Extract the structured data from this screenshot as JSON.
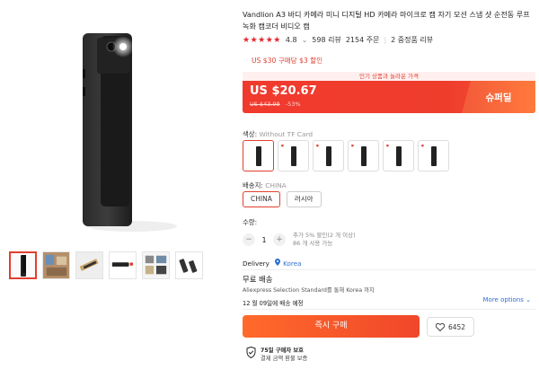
{
  "product": {
    "title": "Vandlion A3 바디 카메라 미니 디지털 HD 카메라 마이크로 캠 자기 모션 스냅 샷 순전동 루프 녹화 캠코더 비디오 캠",
    "rating": "4.8",
    "reviews": "598 리뷰",
    "orders": "2154 주문",
    "repeat_buyers": "2 중정품 리뷰"
  },
  "coupon_text": "US $30 구매당 $3 할인",
  "price": {
    "promo_banner": "인기 상품과 놀라운 가격",
    "current": "US $20.67",
    "original": "US $43.98",
    "discount": "-53%",
    "badge": "슈퍼딜"
  },
  "color": {
    "label": "색상:",
    "selected": "Without TF Card",
    "option_count": 6
  },
  "ship_from": {
    "label": "배송지:",
    "selected": "CHINA",
    "options": [
      "CHINA",
      "러시아"
    ]
  },
  "quantity": {
    "label": "수량:",
    "value": "1",
    "minus": "−",
    "plus": "+",
    "note1": "추가 5% 할인(2 개 이상)",
    "note2": "86 개 사용 가능"
  },
  "delivery": {
    "label": "Delivery",
    "location": "Korea"
  },
  "shipping": {
    "title": "무료 배송",
    "method": "Aliexpress Selection Standard를 통해 Korea 까지",
    "more": "More options",
    "eta": "12 월 09일에 배송 예정"
  },
  "actions": {
    "buy_now": "즉시 구매",
    "wishlist_count": "6452"
  },
  "protection": {
    "line1": "75일 구매자 보호",
    "line2": "결제 금액 환불 보증"
  },
  "colors": {
    "accent": "#e23f2f",
    "link": "#2e6fd3",
    "price_bar": "#f03a2e"
  }
}
